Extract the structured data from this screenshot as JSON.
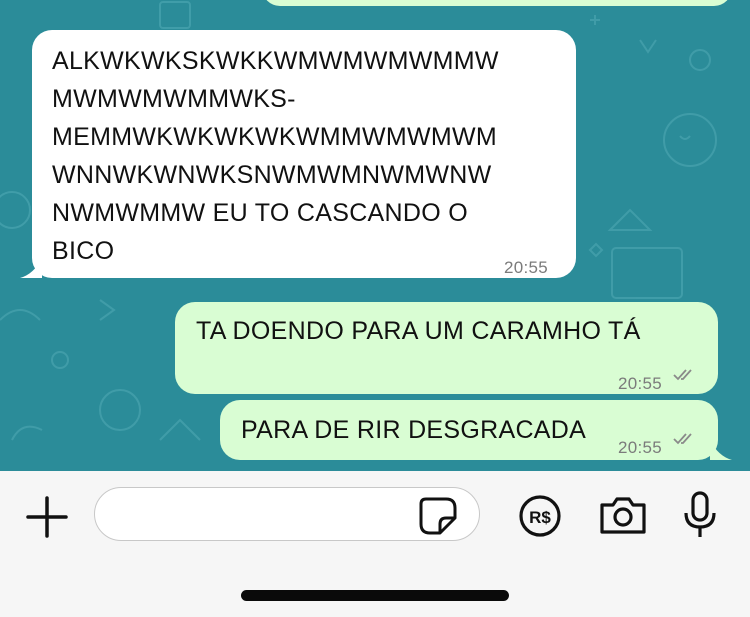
{
  "theme": {
    "chat_background": "#2b8c99",
    "incoming_bubble": "#ffffff",
    "outgoing_bubble": "#d9fdd3",
    "composer_background": "#f6f6f6"
  },
  "messages": [
    {
      "direction": "incoming",
      "text": "ALKWKWKSKWKKWMWMWMWMMW\nMWMWMWMMWKS-\nMEMMWKWKWKWKWMMWMWMWM\nWNNWKWNWKSNWMWMNWMWNW\nNWMWMMW EU TO CASCANDO O\nBICO",
      "time": "20:55"
    },
    {
      "direction": "outgoing",
      "text": "TA DOENDO PARA UM CARAMHO TÁ",
      "time": "20:55",
      "status_icon": "double-check-icon"
    },
    {
      "direction": "outgoing",
      "text": "PARA DE RIR DESGRACADA",
      "time": "20:55",
      "status_icon": "double-check-icon"
    }
  ],
  "composer": {
    "input_value": "",
    "icons": [
      "plus-icon",
      "sticker-icon",
      "brazilian-real-payment-icon",
      "camera-icon",
      "microphone-icon"
    ]
  }
}
